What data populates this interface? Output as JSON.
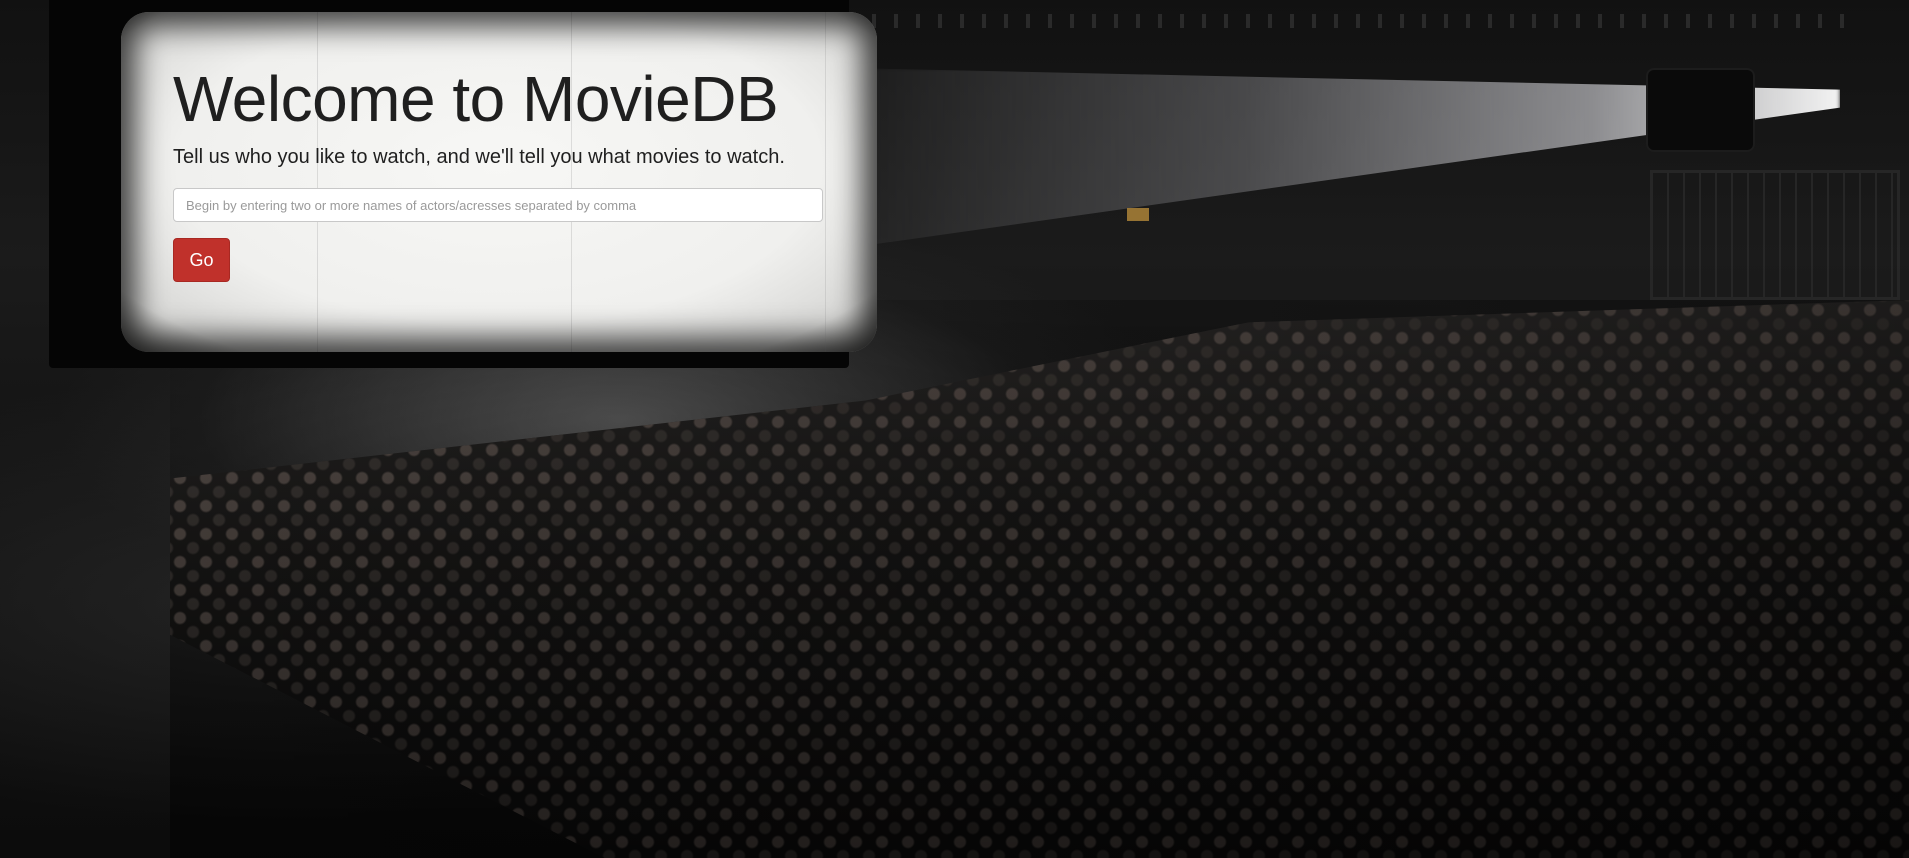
{
  "hero": {
    "title": "Welcome to MovieDB",
    "subtitle": "Tell us who you like to watch, and we'll tell you what movies to watch."
  },
  "search": {
    "value": "",
    "placeholder": "Begin by entering two or more names of actors/acresses separated by comma"
  },
  "actions": {
    "go_label": "Go"
  },
  "colors": {
    "primary_button": "#c0312b",
    "title_text": "#1f1f1f",
    "background": "#0d0d0d"
  }
}
